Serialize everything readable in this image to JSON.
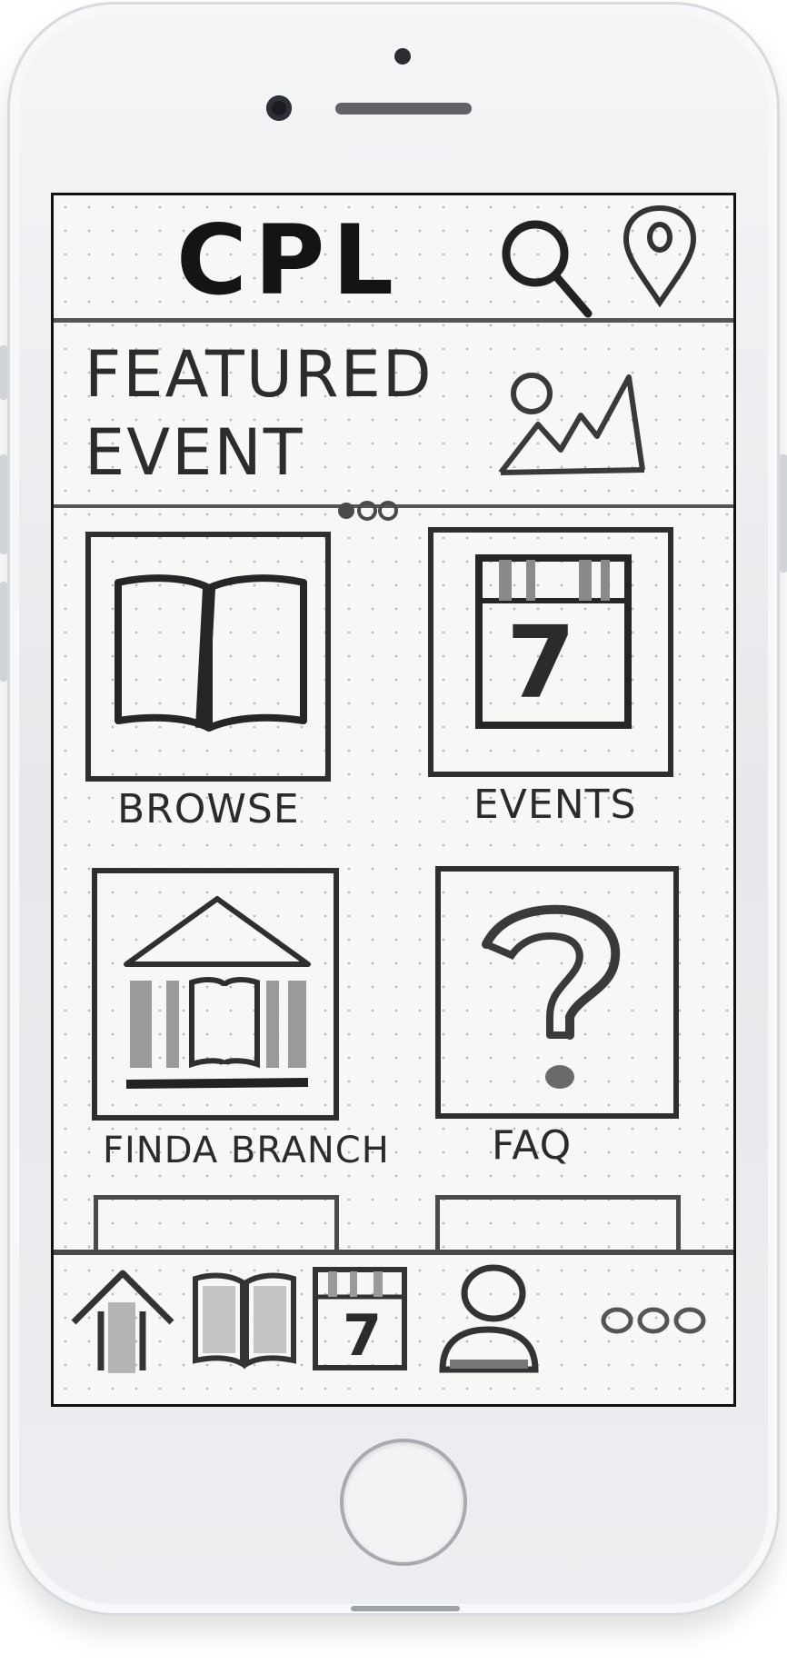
{
  "header": {
    "brand": "CPL"
  },
  "featured": {
    "title": "FEATURED EVENT"
  },
  "tiles": [
    {
      "label": "BROWSE"
    },
    {
      "label": "EVENTS",
      "calendar_day": "7"
    },
    {
      "label": "FINDA BRANCH"
    },
    {
      "label": "FAQ"
    }
  ],
  "tabbar": {
    "calendar_day": "7"
  }
}
